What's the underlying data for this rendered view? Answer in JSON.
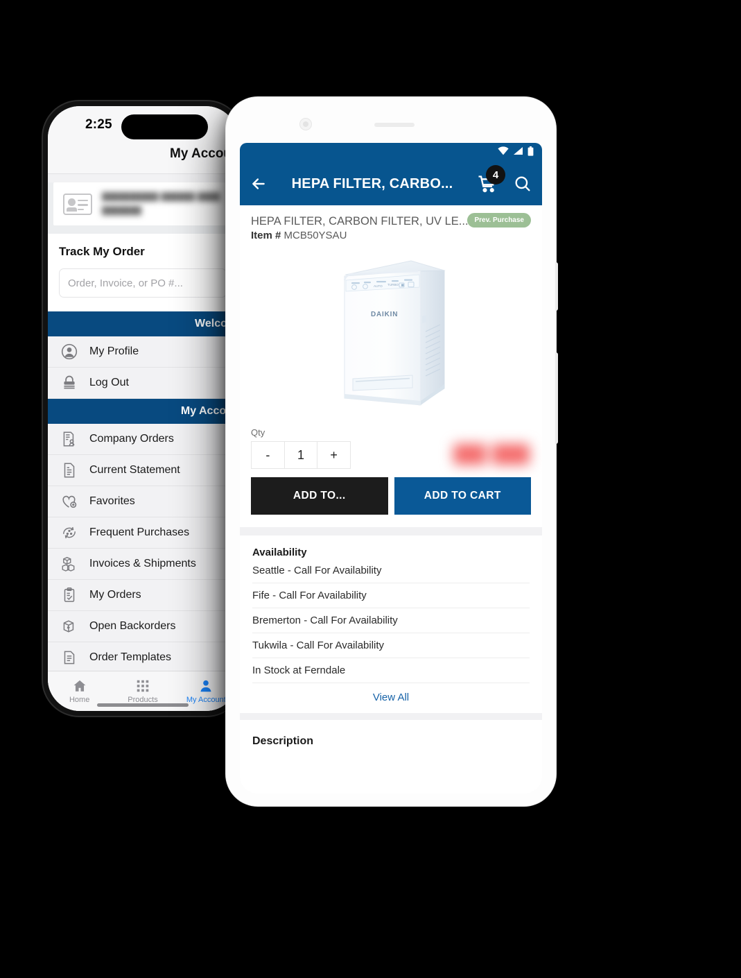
{
  "left_phone": {
    "status_bar": {
      "time": "2:25"
    },
    "nav_title": "My Account",
    "account_card": {
      "icon": "id-card-icon",
      "line1_redacted": "██████████ ██████ ████",
      "line2_redacted": "███████"
    },
    "track_order": {
      "title": "Track My Order",
      "placeholder": "Order, Invoice, or PO #...",
      "value": ""
    },
    "section_welcome": "Welcome",
    "section_my_account": "My Account",
    "welcome_items": [
      {
        "label": "My Profile",
        "icon": "user-circle-icon"
      },
      {
        "label": "Log Out",
        "icon": "lock-icon"
      }
    ],
    "account_items": [
      {
        "label": "Company Orders",
        "icon": "company-orders-icon"
      },
      {
        "label": "Current Statement",
        "icon": "statement-document-icon"
      },
      {
        "label": "Favorites",
        "icon": "heart-plus-icon"
      },
      {
        "label": "Frequent Purchases",
        "icon": "recurring-purchase-icon"
      },
      {
        "label": "Invoices & Shipments",
        "icon": "boxes-icon"
      },
      {
        "label": "My Orders",
        "icon": "clipboard-check-icon"
      },
      {
        "label": "Open Backorders",
        "icon": "box-return-icon"
      },
      {
        "label": "Order Templates",
        "icon": "template-document-icon"
      }
    ],
    "tabs": [
      {
        "label": "Home",
        "icon": "home-icon",
        "active": false
      },
      {
        "label": "Products",
        "icon": "grid-icon",
        "active": false
      },
      {
        "label": "My Account",
        "icon": "person-icon",
        "active": true
      }
    ]
  },
  "right_phone": {
    "status_bar": {
      "icons": [
        "wifi-icon",
        "signal-icon",
        "battery-icon"
      ]
    },
    "app_bar": {
      "back_icon": "back-arrow-icon",
      "title": "HEPA FILTER, CARBO...",
      "cart_icon": "shopping-cart-icon",
      "cart_count": "4",
      "search_icon": "search-icon"
    },
    "product": {
      "name": "HEPA FILTER, CARBON FILTER, UV LE...",
      "item_label": "Item #",
      "item_number": "MCB50YSAU",
      "badge": "Prev. Purchase",
      "image_alt": "daikin-air-purifier-image"
    },
    "qty": {
      "label": "Qty",
      "decrement": "-",
      "value": "1",
      "increment": "+"
    },
    "price_redacted": "████.██",
    "buttons": {
      "add_to": "ADD TO...",
      "add_to_cart": "ADD TO CART"
    },
    "availability": {
      "title": "Availability",
      "rows": [
        "Seattle - Call For Availability",
        "Fife - Call For Availability",
        "Bremerton - Call For Availability",
        "Tukwila - Call For Availability",
        "In Stock at Ferndale"
      ],
      "view_all": "View All"
    },
    "description_section": "Description"
  },
  "colors": {
    "brand_blue": "#07558f",
    "section_blue": "#084a80",
    "cta_blue": "#0a5997",
    "cta_dark": "#1c1c1c",
    "badge_green": "#9cbf95",
    "link_blue": "#1763a8",
    "ios_active": "#1a82f7"
  }
}
